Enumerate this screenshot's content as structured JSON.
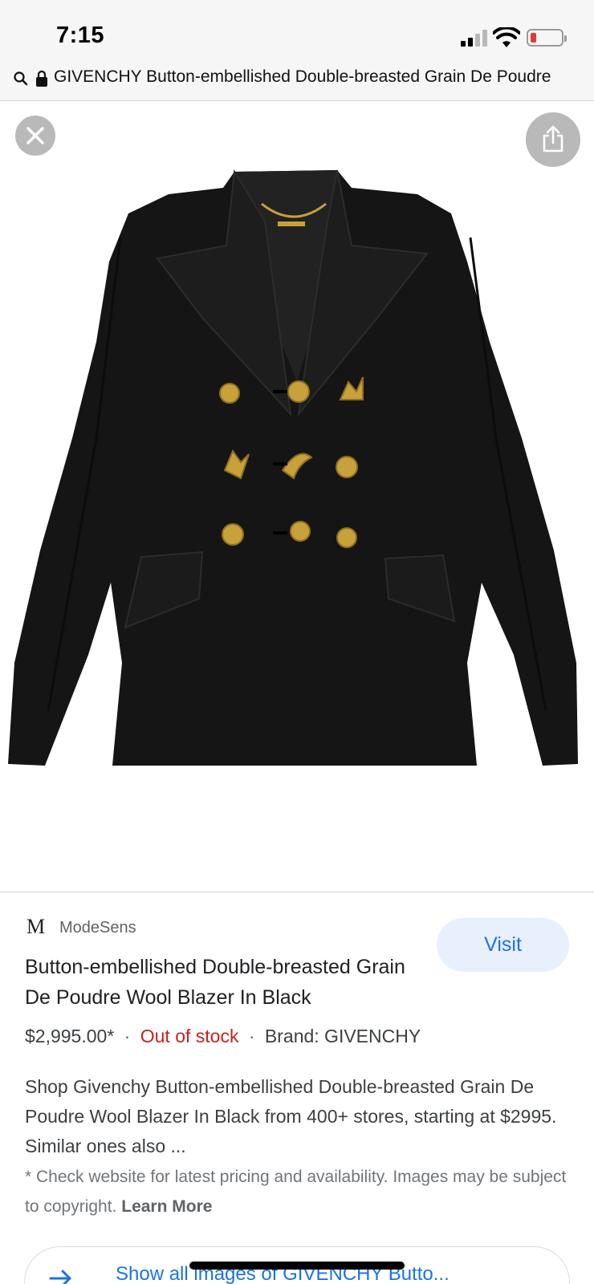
{
  "status_bar": {
    "time": "7:15"
  },
  "url_bar": {
    "text": "GIVENCHY Button-embellished Double-breasted Grain De Poudre"
  },
  "viewer": {
    "close_icon": "close-icon",
    "share_icon": "share-icon"
  },
  "result": {
    "source_logo": "M",
    "source_name": "ModeSens",
    "visit_label": "Visit",
    "title": "Button-embellished Double-breasted Grain De Poudre Wool Blazer In Black",
    "price": "$2,995.00*",
    "separator": "·",
    "stock_status": "Out of stock",
    "brand": "Brand: GIVENCHY",
    "description": "Shop Givenchy Button-embellished Double-breasted Grain De Poudre Wool Blazer In Black from 400+ stores, starting at $2995. Similar ones also ...",
    "disclaimer": "* Check website for latest pricing and availability. Images may be subject to copyright.",
    "learn_more": "Learn More",
    "show_all_label": "Show all images of GIVENCHY Butto..."
  },
  "colors": {
    "link_blue": "#1a73e8",
    "out_of_stock_red": "#c5221f",
    "visit_bg": "#e8f0fe",
    "blazer": "#151515",
    "buttons_gold": "#c9a13a"
  }
}
